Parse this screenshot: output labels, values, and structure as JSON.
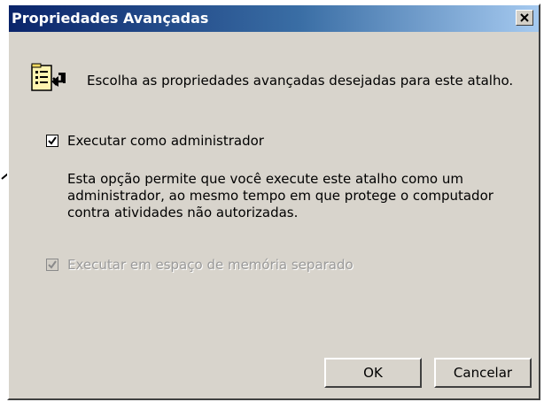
{
  "dialog": {
    "title": "Propriedades Avançadas",
    "header_text": "Escolha as propriedades avançadas desejadas para este atalho.",
    "header_icon": "shortcut-properties-icon"
  },
  "options": {
    "run_as_admin": {
      "label": "Executar como administrador",
      "checked": true,
      "enabled": true,
      "description_lines": [
        "Esta opção permite que você execute este atalho como um",
        "administrador, ao mesmo tempo em que protege o computador",
        "contra atividades não autorizadas."
      ]
    },
    "separate_memory": {
      "label": "Executar em espaço de memória separado",
      "checked": true,
      "enabled": false
    }
  },
  "buttons": {
    "ok_label": "OK",
    "cancel_label": "Cancelar"
  },
  "colors": {
    "titlebar_start": "#0a246a",
    "titlebar_end": "#a6caf0",
    "dialog_face": "#d8d4cc",
    "disabled_text": "#9a9a9a"
  }
}
